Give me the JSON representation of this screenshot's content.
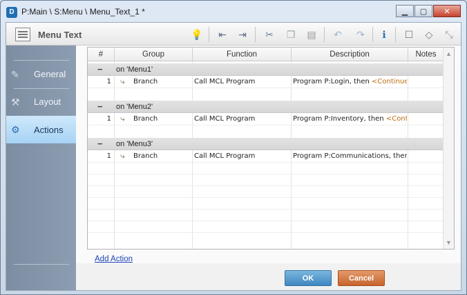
{
  "window": {
    "app_icon": "D",
    "title": "P:Main \\ S:Menu \\ Menu_Text_1 *",
    "minimize_icon": "minimize-icon",
    "maximize_icon": "maximize-icon",
    "close_icon": "close-icon"
  },
  "header": {
    "title": "Menu Text",
    "toolbar_icons": [
      "lightbulb-icon",
      "outdent-icon",
      "indent-icon",
      "cut-icon",
      "copy-icon",
      "paste-icon",
      "undo-icon",
      "redo-icon",
      "info-icon",
      "comment-icon",
      "tag-icon",
      "expand-icon"
    ]
  },
  "sidebar": {
    "items": [
      {
        "label": "General",
        "icon": "general-icon",
        "active": false
      },
      {
        "label": "Layout",
        "icon": "layout-icon",
        "active": false
      },
      {
        "label": "Actions",
        "icon": "actions-icon",
        "active": true
      }
    ]
  },
  "grid": {
    "columns": [
      "#",
      "Group",
      "Function",
      "Description",
      "Notes"
    ],
    "groups": [
      {
        "label": "on 'Menu1'",
        "rows": [
          {
            "num": "1",
            "group": "Branch",
            "function": "Call MCL Program",
            "description": "Program P:Login, then ",
            "continue": "<Continue"
          }
        ]
      },
      {
        "label": "on 'Menu2'",
        "rows": [
          {
            "num": "1",
            "group": "Branch",
            "function": "Call MCL Program",
            "description": "Program P:Inventory, then ",
            "continue": "<Cont"
          }
        ]
      },
      {
        "label": "on 'Menu3'",
        "rows": [
          {
            "num": "1",
            "group": "Branch",
            "function": "Call MCL Program",
            "description": "Program P:Communications, ther",
            "continue": ""
          }
        ]
      }
    ]
  },
  "footer": {
    "add_action": "Add Action",
    "ok_label": "OK",
    "cancel_label": "Cancel"
  },
  "colors": {
    "accent": "#3f87c1",
    "cancel": "#c8632c",
    "continue_text": "#c06b12"
  }
}
